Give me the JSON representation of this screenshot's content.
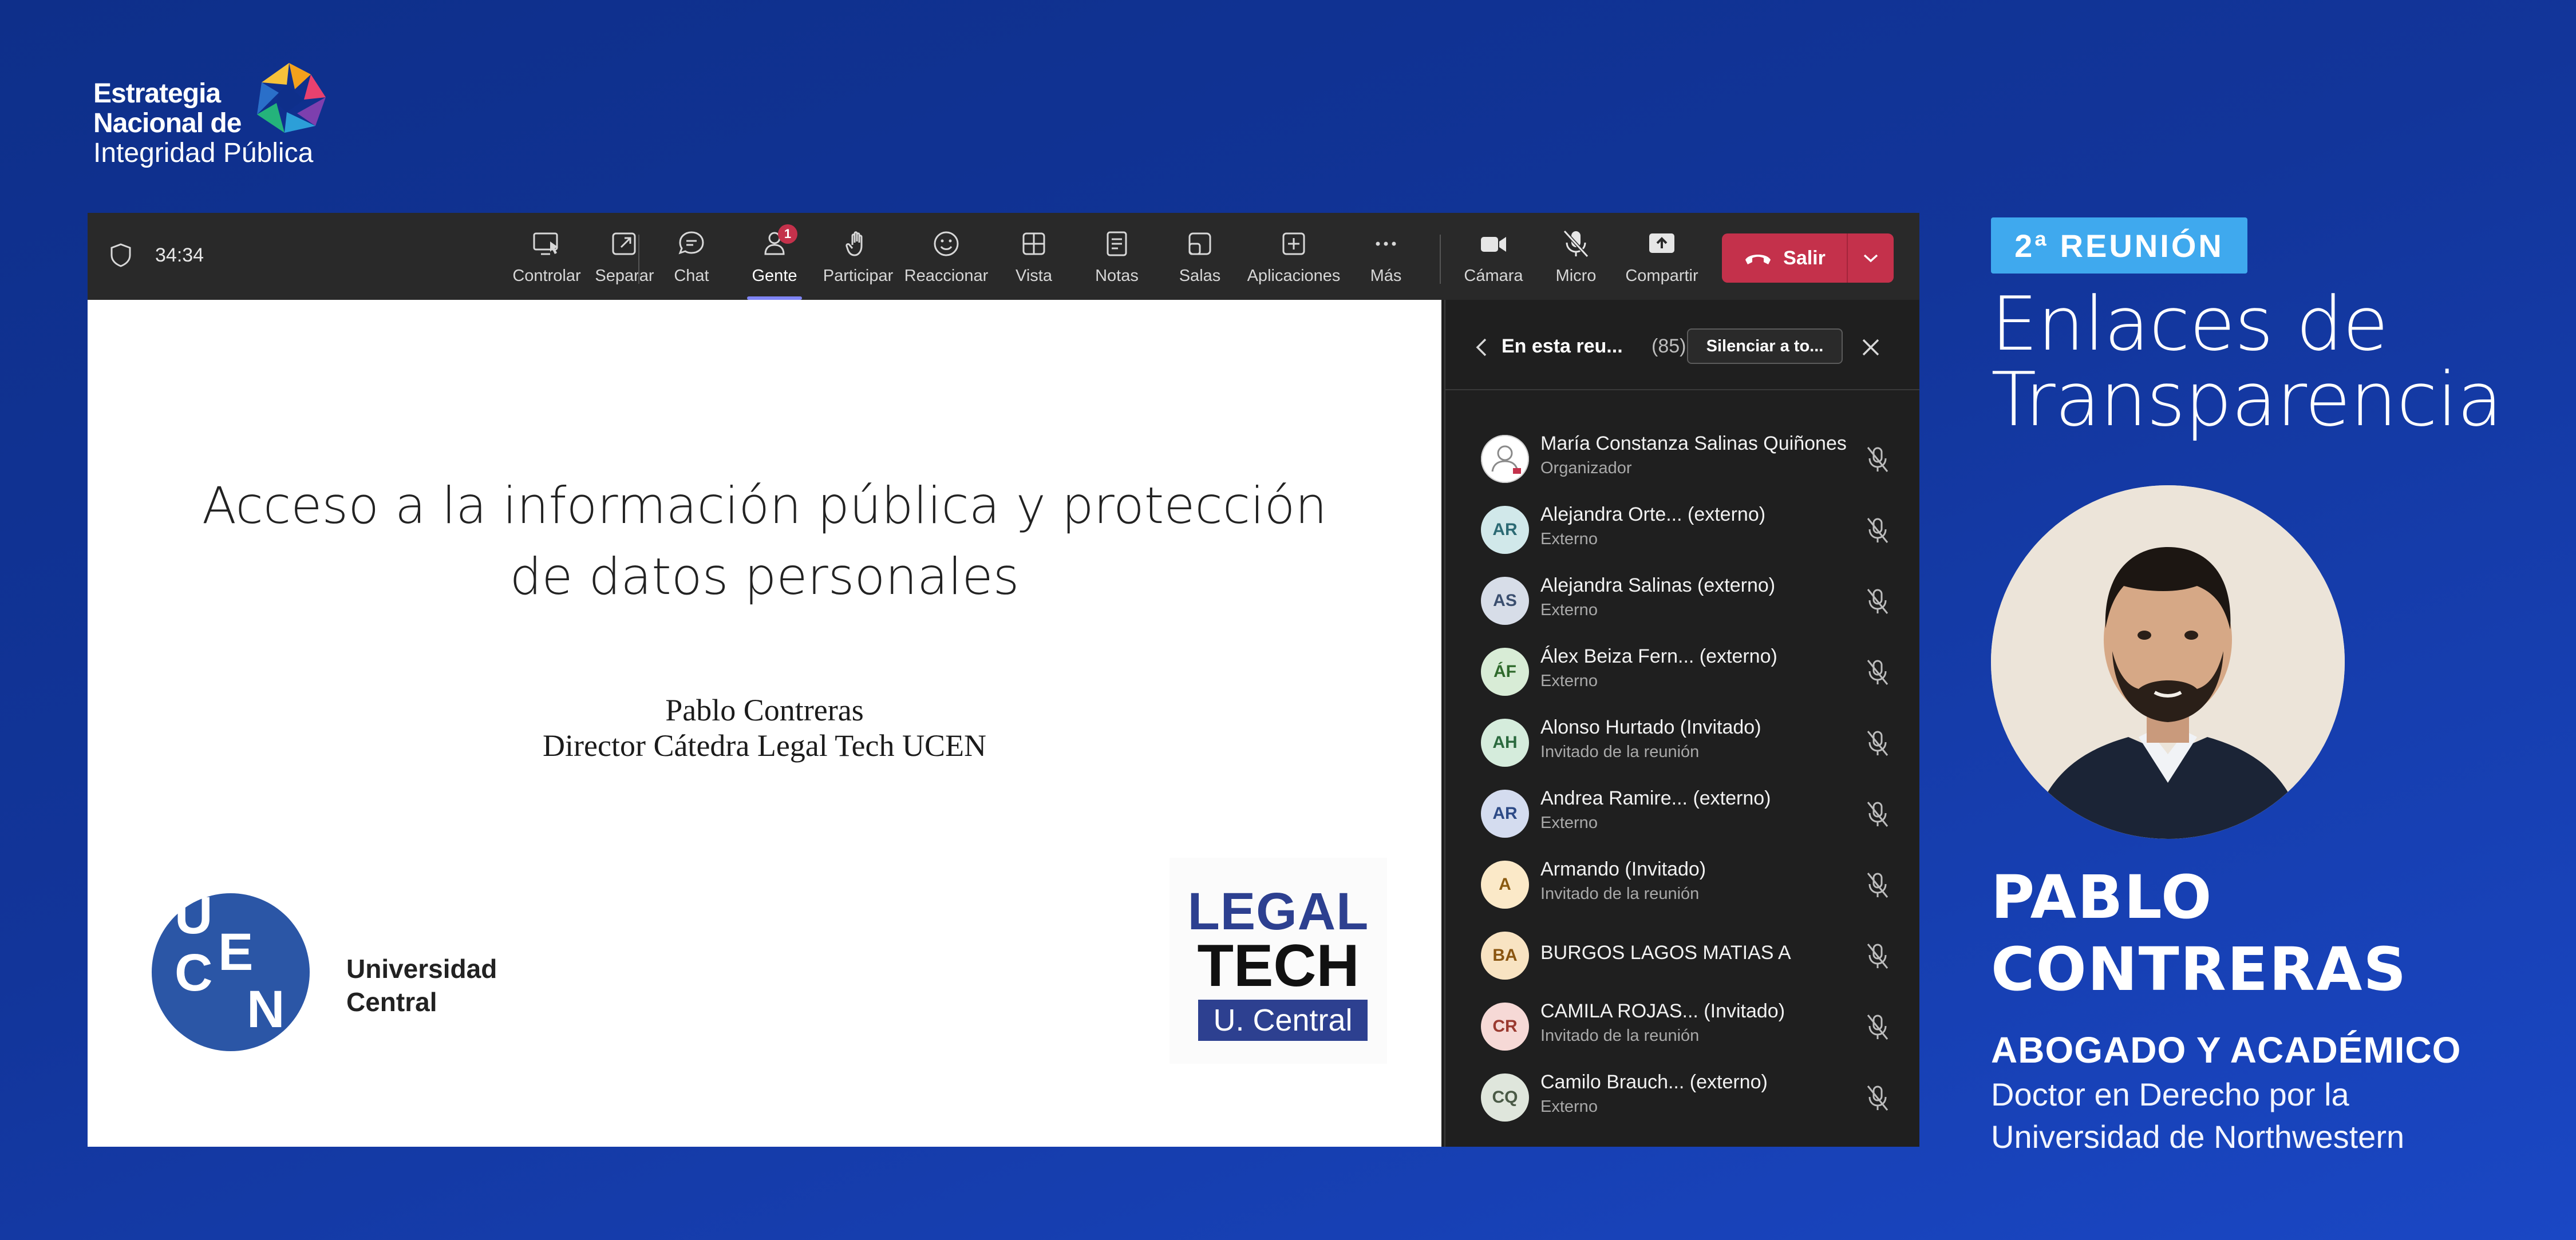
{
  "brand": {
    "line1": "Estrategia",
    "line2": "Nacional de",
    "line3": "Integridad Pública"
  },
  "meeting": {
    "timer": "34:34",
    "toolbar": [
      {
        "label": "Controlar",
        "icon": "screen-control-icon"
      },
      {
        "label": "Separar",
        "icon": "pop-out-icon"
      },
      {
        "label": "Chat",
        "icon": "chat-icon"
      },
      {
        "label": "Gente",
        "icon": "people-icon",
        "badge": "1",
        "active": true
      },
      {
        "label": "Participar",
        "icon": "raise-hand-icon"
      },
      {
        "label": "Reaccionar",
        "icon": "smile-icon"
      },
      {
        "label": "Vista",
        "icon": "grid-view-icon"
      },
      {
        "label": "Notas",
        "icon": "notes-icon"
      },
      {
        "label": "Salas",
        "icon": "rooms-icon"
      },
      {
        "label": "Aplicaciones",
        "icon": "add-apps-icon"
      },
      {
        "label": "Más",
        "icon": "more-icon"
      },
      {
        "label": "Cámara",
        "icon": "camera-icon"
      },
      {
        "label": "Micro",
        "icon": "mic-off-icon"
      },
      {
        "label": "Compartir",
        "icon": "share-icon"
      }
    ],
    "leave_label": "Salir",
    "colors": {
      "leave": "#c4314b",
      "active_indicator": "#7f85f5",
      "toolbar_bg": "#292929"
    }
  },
  "slide": {
    "title": "Acceso a la información pública y protección de datos personales",
    "author": "Pablo Contreras",
    "author_title": "Director Cátedra Legal Tech UCEN",
    "ucen_logo_text": "UCEN",
    "ucen_name_line1": "Universidad",
    "ucen_name_line2": "Central",
    "legal_tech_line1": "LEGAL",
    "legal_tech_line2": "TECH",
    "legal_tech_line3": "U. Central"
  },
  "participants_panel": {
    "title": "En esta reu...",
    "count": "(85)",
    "mute_all_label": "Silenciar a to...",
    "participants": [
      {
        "initials": "",
        "name": "María Constanza Salinas Quiñones",
        "role": "Organizador",
        "avatar_bg": "#ffffff",
        "avatar_fg": "#8a8a8a"
      },
      {
        "initials": "AR",
        "name": "Alejandra Orte...  (externo)",
        "role": "Externo",
        "avatar_bg": "#d1e8ea",
        "avatar_fg": "#2c6a74"
      },
      {
        "initials": "AS",
        "name": "Alejandra Salinas (externo)",
        "role": "Externo",
        "avatar_bg": "#d7dde8",
        "avatar_fg": "#3a4e6e"
      },
      {
        "initials": "ÁF",
        "name": "Álex Beiza Fern...  (externo)",
        "role": "Externo",
        "avatar_bg": "#d8ecd6",
        "avatar_fg": "#2f6a2c"
      },
      {
        "initials": "AH",
        "name": "Alonso Hurtado (Invitado)",
        "role": "Invitado de la reunión",
        "avatar_bg": "#d5ecdc",
        "avatar_fg": "#2b6a3e"
      },
      {
        "initials": "AR",
        "name": "Andrea Ramire...  (externo)",
        "role": "Externo",
        "avatar_bg": "#d4dcef",
        "avatar_fg": "#2d4a86"
      },
      {
        "initials": "A",
        "name": "Armando (Invitado)",
        "role": "Invitado de la reunión",
        "avatar_bg": "#fbe9c8",
        "avatar_fg": "#8a5a10"
      },
      {
        "initials": "BA",
        "name": "BURGOS LAGOS MATIAS A",
        "role": "",
        "avatar_bg": "#f8e3c2",
        "avatar_fg": "#8a5510"
      },
      {
        "initials": "CR",
        "name": "CAMILA ROJAS... (Invitado)",
        "role": "Invitado de la reunión",
        "avatar_bg": "#f6d9d6",
        "avatar_fg": "#9a3a30"
      },
      {
        "initials": "CQ",
        "name": "Camilo Brauch...  (externo)",
        "role": "Externo",
        "avatar_bg": "#dfe6dc",
        "avatar_fg": "#4a5a46"
      }
    ]
  },
  "event": {
    "tag": "2ª REUNIÓN",
    "title_line1": "Enlaces de",
    "title_line2": "Transparencia",
    "speaker_line1": "PABLO",
    "speaker_line2": "CONTRERAS",
    "role": "ABOGADO Y ACADÉMICO",
    "desc_line1": "Doctor en Derecho por la",
    "desc_line2": "Universidad de Northwestern",
    "tag_color": "#3fa9ee"
  }
}
